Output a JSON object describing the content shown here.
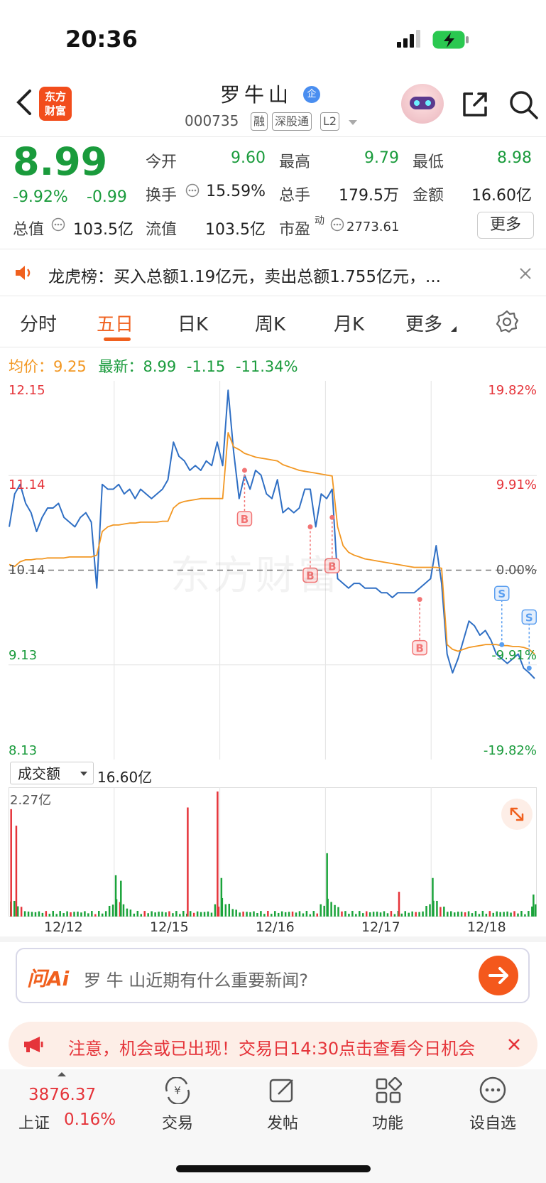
{
  "status_bar": {
    "time": "20:36"
  },
  "header": {
    "logo_text_1": "东方",
    "logo_text_2": "财富",
    "stock_name": "罗牛山",
    "badge": "企",
    "code": "000735",
    "tags": [
      "融",
      "深股通",
      "L2"
    ]
  },
  "quote": {
    "price": "8.99",
    "change_pct": "-9.92%",
    "change": "-0.99",
    "rows": [
      [
        {
          "label": "今开",
          "value": "9.60",
          "color": "green"
        },
        {
          "label": "最高",
          "value": "9.79",
          "color": "green"
        },
        {
          "label": "最低",
          "value": "8.98",
          "color": "green"
        }
      ],
      [
        {
          "label": "换手",
          "value": "15.59%",
          "color": "dark"
        },
        {
          "label": "总手",
          "value": "179.5万",
          "color": "dark"
        },
        {
          "label": "金额",
          "value": "16.60亿",
          "color": "dark"
        }
      ],
      [
        {
          "label": "总值",
          "value": "103.5亿",
          "color": "dark"
        },
        {
          "label": "流值",
          "value": "103.5亿",
          "color": "dark"
        },
        {
          "label": "市盈",
          "sup": "动",
          "value": "2773.61",
          "color": "dark"
        }
      ]
    ],
    "more_label": "更多"
  },
  "news": {
    "text": "龙虎榜：买入总额1.19亿元，卖出总额1.755亿元，..."
  },
  "tabs": [
    "分时",
    "五日",
    "日K",
    "周K",
    "月K",
    "更多"
  ],
  "active_tab": "五日",
  "chart_info": {
    "avg_label": "均价：",
    "avg_value": "9.25",
    "latest_label": "最新：",
    "latest_value": "8.99",
    "latest_change": "-1.15",
    "latest_pct": "-11.34%"
  },
  "watermark": "东方财富",
  "chart_data": {
    "type": "line",
    "y_left_ticks": [
      "12.15",
      "11.14",
      "10.14",
      "9.13",
      "8.13"
    ],
    "y_right_ticks": [
      "19.82%",
      "9.91%",
      "0.00%",
      "-9.91%",
      "-19.82%"
    ],
    "ylim": [
      8.13,
      12.15
    ],
    "prev_close": 10.14,
    "x_labels": [
      "12/12",
      "12/15",
      "12/16",
      "12/17",
      "12/18"
    ],
    "series": [
      {
        "type": "line",
        "color": "#2f6fc4",
        "values": [
          10.6,
          10.95,
          11.05,
          10.85,
          10.75,
          10.55,
          10.7,
          10.8,
          10.8,
          10.85,
          10.7,
          10.65,
          10.6,
          10.7,
          10.75,
          10.65,
          9.95,
          11.05,
          11.0,
          11.0,
          11.05,
          10.95,
          11.0,
          10.9,
          11.0,
          10.95,
          10.9,
          10.95,
          11.0,
          11.1,
          11.5,
          11.35,
          11.3,
          11.2,
          11.25,
          11.2,
          11.3,
          11.25,
          11.5,
          11.25,
          12.05,
          11.4,
          10.9,
          11.15,
          11.0,
          11.2,
          11.15,
          10.95,
          10.9,
          11.1,
          10.75,
          10.8,
          10.75,
          10.8,
          11.0,
          11.0,
          10.6,
          10.95,
          10.9,
          11.0,
          10.05,
          10.0,
          9.95,
          10.0,
          10.0,
          9.95,
          9.95,
          9.95,
          9.9,
          9.9,
          9.85,
          9.9,
          9.9,
          9.9,
          9.9,
          9.95,
          10.0,
          10.05,
          10.4,
          10.0,
          9.25,
          9.05,
          9.2,
          9.4,
          9.6,
          9.55,
          9.45,
          9.5,
          9.4,
          9.25,
          9.2,
          9.15,
          9.2,
          9.25,
          9.1,
          9.05,
          8.99
        ]
      },
      {
        "type": "line",
        "color": "#f29722",
        "values": [
          10.2,
          10.18,
          10.23,
          10.25,
          10.25,
          10.26,
          10.26,
          10.27,
          10.27,
          10.27,
          10.27,
          10.28,
          10.28,
          10.28,
          10.28,
          10.28,
          10.3,
          10.55,
          10.6,
          10.62,
          10.62,
          10.63,
          10.64,
          10.64,
          10.65,
          10.65,
          10.65,
          10.65,
          10.66,
          10.66,
          10.8,
          10.85,
          10.87,
          10.88,
          10.89,
          10.9,
          10.9,
          10.9,
          10.9,
          10.9,
          11.6,
          11.45,
          11.42,
          11.38,
          11.36,
          11.34,
          11.33,
          11.32,
          11.31,
          11.3,
          11.26,
          11.24,
          11.22,
          11.2,
          11.19,
          11.18,
          11.17,
          11.16,
          11.15,
          11.14,
          10.6,
          10.4,
          10.33,
          10.3,
          10.28,
          10.26,
          10.25,
          10.24,
          10.23,
          10.22,
          10.21,
          10.2,
          10.19,
          10.18,
          10.17,
          10.17,
          10.17,
          10.17,
          10.17,
          10.16,
          9.35,
          9.3,
          9.28,
          9.3,
          9.32,
          9.33,
          9.34,
          9.35,
          9.35,
          9.35,
          9.34,
          9.34,
          9.33,
          9.33,
          9.32,
          9.3,
          9.25
        ]
      }
    ],
    "markers": [
      {
        "label": "B",
        "idx": 43,
        "price": 11.2,
        "dir": "down"
      },
      {
        "label": "B",
        "idx": 55,
        "price": 10.6,
        "dir": "down"
      },
      {
        "label": "B",
        "idx": 59,
        "price": 10.7,
        "dir": "down"
      },
      {
        "label": "B",
        "idx": 75,
        "price": 9.83,
        "dir": "down"
      },
      {
        "label": "S",
        "idx": 90,
        "price": 9.35,
        "dir": "up"
      },
      {
        "label": "S",
        "idx": 95,
        "price": 9.1,
        "dir": "up"
      }
    ],
    "volume": {
      "label": "成交额",
      "total": "16.60亿",
      "max_label": "2.27亿",
      "max": 2.27,
      "spikes": [
        {
          "day": 0,
          "pos": 0.01,
          "value": 1.95,
          "color": "red"
        },
        {
          "day": 0,
          "pos": 0.06,
          "value": 1.65,
          "color": "red"
        },
        {
          "day": 1,
          "pos": 0.0,
          "value": 0.75,
          "color": "green"
        },
        {
          "day": 1,
          "pos": 0.05,
          "value": 0.65,
          "color": "green"
        },
        {
          "day": 1,
          "pos": 0.7,
          "value": 1.98,
          "color": "red"
        },
        {
          "day": 1,
          "pos": 0.99,
          "value": 2.27,
          "color": "red"
        },
        {
          "day": 2,
          "pos": 0.0,
          "value": 0.7,
          "color": "green"
        },
        {
          "day": 3,
          "pos": 0.0,
          "value": 1.15,
          "color": "green"
        },
        {
          "day": 3,
          "pos": 0.7,
          "value": 0.45,
          "color": "red"
        },
        {
          "day": 4,
          "pos": 0.0,
          "value": 0.7,
          "color": "green"
        },
        {
          "day": 4,
          "pos": 0.98,
          "value": 0.4,
          "color": "green"
        }
      ]
    }
  },
  "ai_bar": {
    "logo": "问Ai",
    "placeholder": "罗 牛 山近期有什么重要新闻?"
  },
  "notice": {
    "text": "注意，机会或已出现！交易日14:30点击查看今日机会"
  },
  "tabbar": {
    "index_value": "3876.37",
    "index_name": "上证",
    "index_pct": "0.16%",
    "items": [
      "交易",
      "发帖",
      "功能",
      "设自选"
    ]
  }
}
